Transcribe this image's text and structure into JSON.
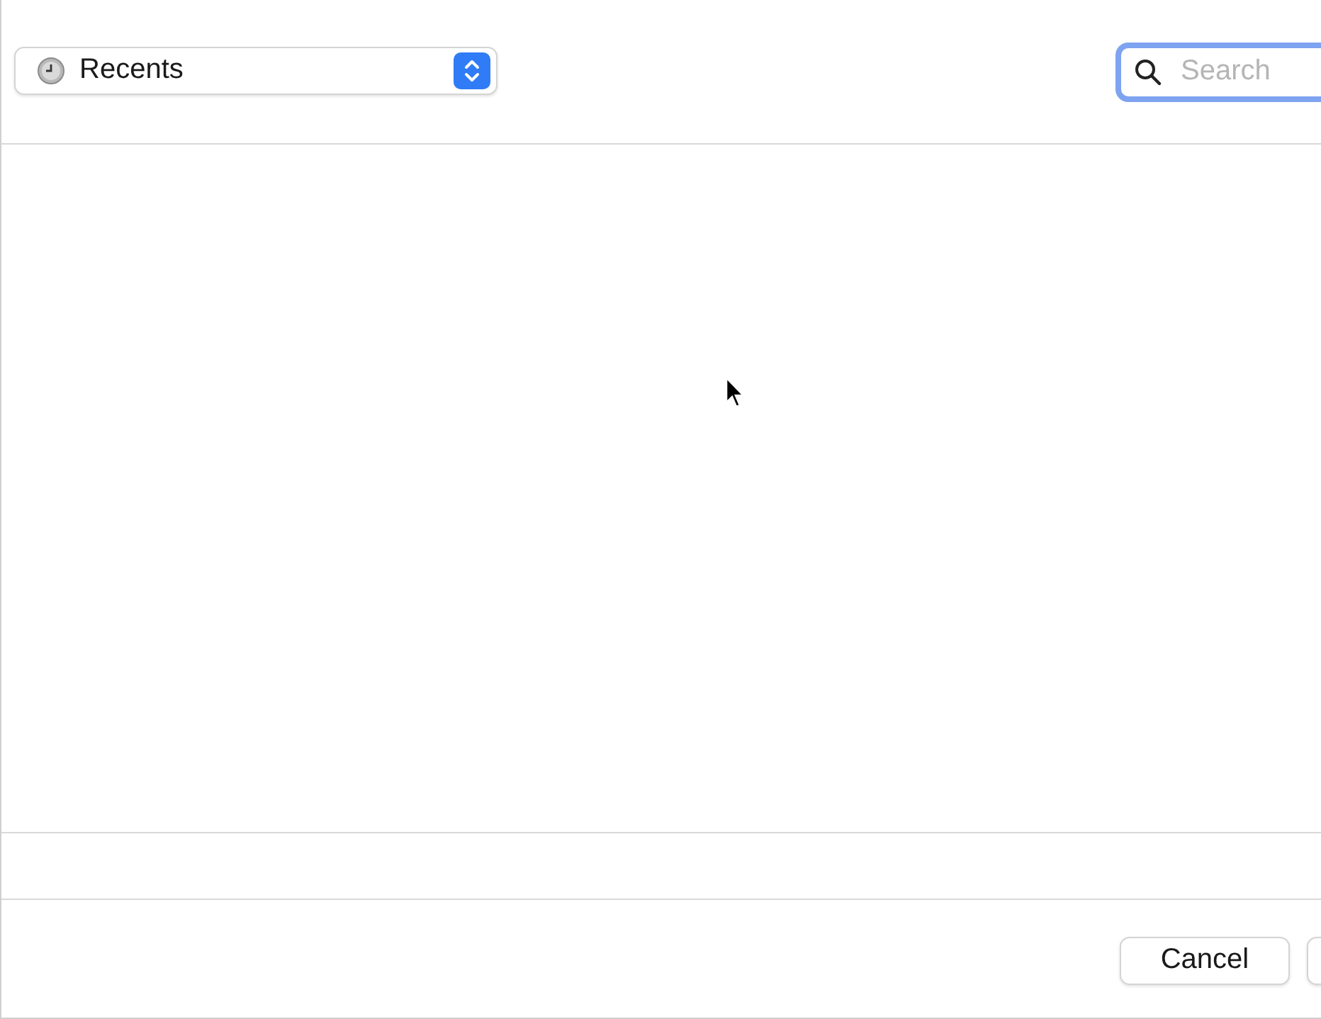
{
  "location_popup": {
    "label": "Recents"
  },
  "search": {
    "placeholder": "Search",
    "focused": true
  },
  "buttons": [
    {
      "label": "Cancel"
    }
  ]
}
